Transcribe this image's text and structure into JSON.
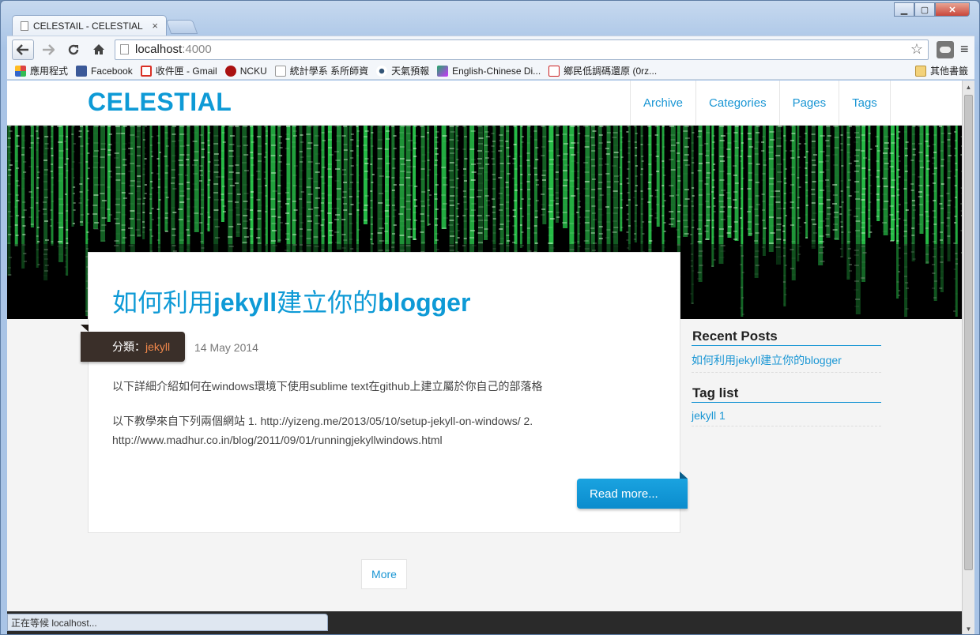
{
  "browser": {
    "tab_title": "CELESTAIL - CELESTIAL",
    "tab_close": "×",
    "url_host": "localhost",
    "url_port": ":4000",
    "window_buttons": [
      "▁",
      "▢",
      "✕"
    ],
    "status": "正在等候 localhost...",
    "bookmarks": [
      {
        "label": "應用程式",
        "icon": "apps-grid-icon",
        "color": "#d44"
      },
      {
        "label": "Facebook",
        "icon": "facebook-icon",
        "color": "#3b5998"
      },
      {
        "label": "收件匣 - Gmail",
        "icon": "gmail-icon",
        "color": "#d93025"
      },
      {
        "label": "NCKU",
        "icon": "ncku-icon",
        "color": "#a11"
      },
      {
        "label": "統計學系 系所師資",
        "icon": "page-icon",
        "color": "#ccc"
      },
      {
        "label": "天氣預報",
        "icon": "eye-icon",
        "color": "#357"
      },
      {
        "label": "English-Chinese Di...",
        "icon": "dictionary-icon",
        "color": "#2a6"
      },
      {
        "label": "鄉民低調碼還原 (0rz...",
        "icon": "orz-icon",
        "color": "#c22"
      }
    ],
    "other_bookmarks": "其他書籤"
  },
  "site": {
    "brand": "CELESTIAL",
    "nav": [
      "Archive",
      "Categories",
      "Pages",
      "Tags"
    ]
  },
  "post": {
    "title_cjk_1": "如何利用",
    "title_latin_1": "jekyll",
    "title_cjk_2": "建立你的",
    "title_latin_2": "blogger",
    "category_prefix": "分類：",
    "category": "jekyll",
    "date": "14 May 2014",
    "excerpt_1": "以下詳細介紹如何在windows環境下使用sublime text在github上建立屬於你自己的部落格",
    "excerpt_2": "以下教學來自下列兩個網站 1. http://yizeng.me/2013/05/10/setup-jekyll-on-windows/ 2. http://www.madhur.co.in/blog/2011/09/01/runningjekyllwindows.html",
    "read_more": "Read more..."
  },
  "pagination": {
    "more": "More"
  },
  "sidebar": {
    "recent_heading": "Recent Posts",
    "recent_posts": [
      "如何利用jekyll建立你的blogger"
    ],
    "tag_heading": "Tag list",
    "tags": [
      "jekyll 1"
    ]
  },
  "colors": {
    "accent": "#0e9ad6",
    "ribbon": "#3a2f29",
    "category_link": "#f2884b",
    "matrix_green": "#2bd14f"
  }
}
